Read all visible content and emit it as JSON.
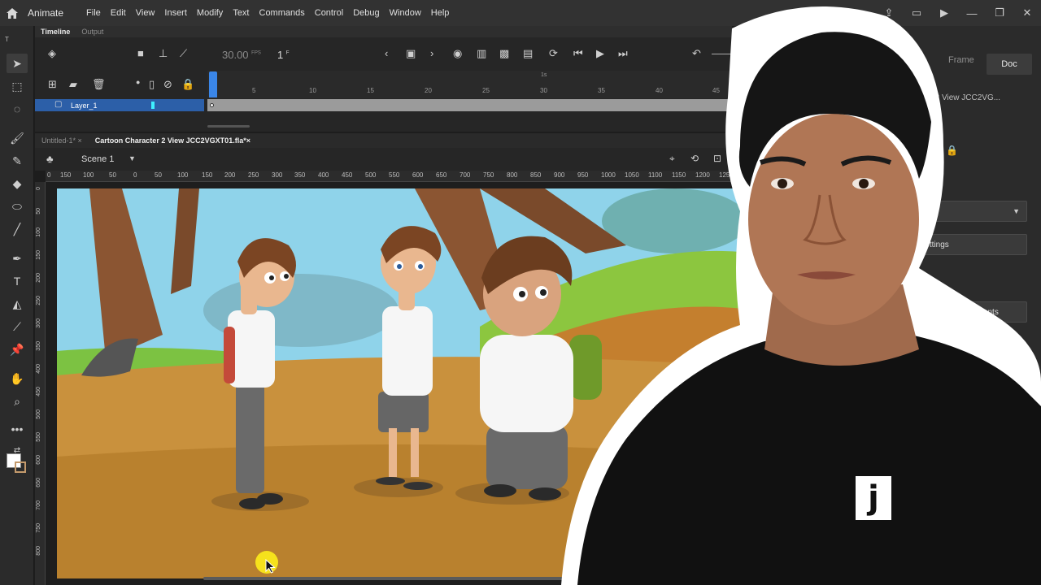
{
  "app": {
    "name": "Animate"
  },
  "menu": [
    "File",
    "Edit",
    "View",
    "Insert",
    "Modify",
    "Text",
    "Commands",
    "Control",
    "Debug",
    "Window",
    "Help"
  ],
  "timeline": {
    "tabs": [
      "Timeline",
      "Output"
    ],
    "fps": "30.00",
    "fps_unit": "FPS",
    "current_frame": "1",
    "frame_unit": "F",
    "seconds_marker": "1s",
    "frame_numbers": [
      "5",
      "10",
      "15",
      "20",
      "25",
      "30",
      "35",
      "40",
      "45"
    ],
    "layer": "Layer_1",
    "layer_label_small": "T"
  },
  "documents": {
    "tabs": [
      "Untitled-1*",
      "Cartoon Character 2 View JCC2VGXT01.fla*"
    ],
    "scene": "Scene 1"
  },
  "ruler": {
    "horizontal": [
      "0",
      "150",
      "100",
      "50",
      "0",
      "50",
      "100",
      "150",
      "200",
      "250",
      "300",
      "350",
      "400",
      "450",
      "500",
      "550",
      "600",
      "650",
      "700",
      "750",
      "800",
      "850",
      "900",
      "950",
      "1000",
      "1050",
      "1100",
      "1150",
      "1200",
      "1250"
    ],
    "vertical": [
      "0",
      "50",
      "100",
      "150",
      "200",
      "250",
      "300",
      "350",
      "400",
      "450",
      "500",
      "550",
      "600",
      "650",
      "700",
      "750",
      "800"
    ]
  },
  "properties": {
    "tabs": [
      "Frame",
      "Doc"
    ],
    "doc_title_partial": "er 2 View JCC2VG...",
    "settings_partial": "e settings",
    "ngs_partial": "ngs",
    "match_contents": "Match contents",
    "content_partial": "ontent"
  },
  "colors": {
    "accent": "#3a86e8",
    "layer_highlight": "#2c5fa8",
    "layer_color": "#3ff0ff",
    "sky": "#8fd3ea",
    "ground": "#c9913d"
  },
  "presenter": {
    "logo_letter": "j"
  }
}
